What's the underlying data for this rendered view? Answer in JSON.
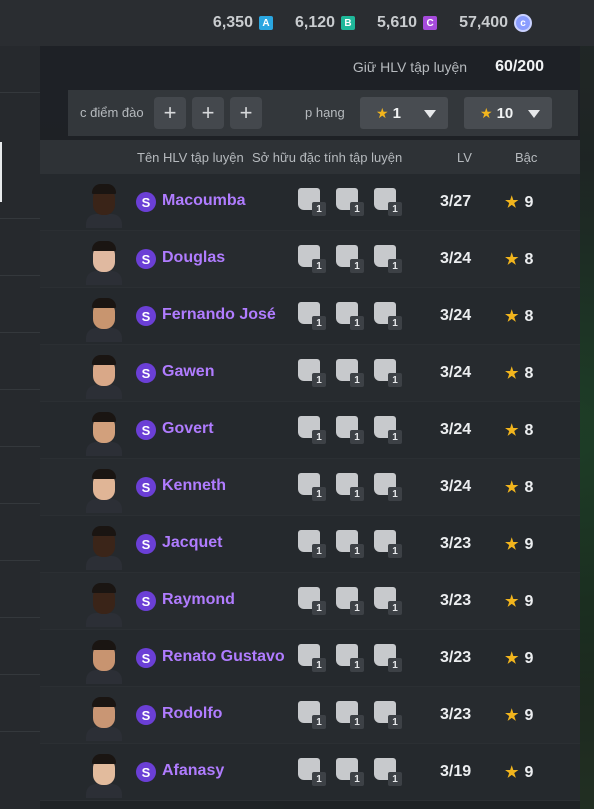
{
  "currencies": [
    {
      "value": "6,350",
      "badge": "A",
      "color": "#2aa6e0"
    },
    {
      "value": "6,120",
      "badge": "B",
      "color": "#1fb89a"
    },
    {
      "value": "5,610",
      "badge": "C",
      "color": "#a64bdc"
    },
    {
      "value": "57,400",
      "badge": "coin",
      "color": "#8a9dff"
    }
  ],
  "capacity": {
    "label": "Giữ HLV tập luyện",
    "value": "60/200"
  },
  "filters": {
    "train_label": "c điểm đào",
    "rank_label": "p hạng",
    "rank_from": "1",
    "rank_to": "10",
    "tilde": "~"
  },
  "columns": {
    "name": "Tên HLV tập luyện",
    "traits": "Sở hữu đặc tính tập luyện",
    "lv": "LV",
    "grade": "Bậc"
  },
  "coaches": [
    {
      "name": "Macoumba",
      "skin": "#3a2418",
      "traits": [
        "1",
        "1",
        "1"
      ],
      "lv": "3/27",
      "grade": "9"
    },
    {
      "name": "Douglas",
      "skin": "#e0b9a0",
      "traits": [
        "1",
        "1",
        "1"
      ],
      "lv": "3/24",
      "grade": "8"
    },
    {
      "name": "Fernando José",
      "skin": "#c8956f",
      "traits": [
        "1",
        "1",
        "1"
      ],
      "lv": "3/24",
      "grade": "8"
    },
    {
      "name": "Gawen",
      "skin": "#d9a888",
      "traits": [
        "1",
        "1",
        "1"
      ],
      "lv": "3/24",
      "grade": "8"
    },
    {
      "name": "Govert",
      "skin": "#d2a07c",
      "traits": [
        "1",
        "1",
        "1"
      ],
      "lv": "3/24",
      "grade": "8"
    },
    {
      "name": "Kenneth",
      "skin": "#e0b596",
      "traits": [
        "1",
        "1",
        "1"
      ],
      "lv": "3/24",
      "grade": "8"
    },
    {
      "name": "Jacquet",
      "skin": "#3b2519",
      "traits": [
        "1",
        "1",
        "1"
      ],
      "lv": "3/23",
      "grade": "9"
    },
    {
      "name": "Raymond",
      "skin": "#3a2418",
      "traits": [
        "1",
        "1",
        "1"
      ],
      "lv": "3/23",
      "grade": "9"
    },
    {
      "name": "Renato Gustavo",
      "skin": "#c89470",
      "traits": [
        "1",
        "1",
        "1"
      ],
      "lv": "3/23",
      "grade": "9"
    },
    {
      "name": "Rodolfo",
      "skin": "#c99674",
      "traits": [
        "1",
        "1",
        "1"
      ],
      "lv": "3/23",
      "grade": "9"
    },
    {
      "name": "Afanasy",
      "skin": "#e2bb9d",
      "traits": [
        "1",
        "1",
        "1"
      ],
      "lv": "3/19",
      "grade": "9"
    }
  ]
}
